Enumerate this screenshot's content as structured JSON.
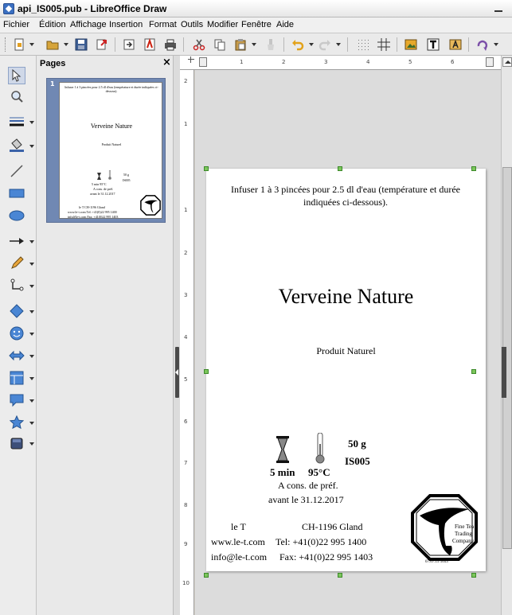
{
  "window": {
    "title": "api_IS005.pub - LibreOffice Draw"
  },
  "menu": [
    "Fichier",
    "Édition",
    "Affichage",
    "Insertion",
    "Format",
    "Outils",
    "Modifier",
    "Fenêtre",
    "Aide"
  ],
  "pages_panel": {
    "title": "Pages",
    "close": "×",
    "page_number": "1"
  },
  "ruler": {
    "h": [
      "1",
      "2",
      "3",
      "4",
      "5",
      "6"
    ],
    "v": [
      "2",
      "1",
      "1",
      "2",
      "3",
      "4",
      "5",
      "6",
      "7",
      "8",
      "9",
      "10"
    ]
  },
  "label": {
    "infuse": "Infuser 1 à 3 pincées pour 2.5 dl d'eau (température et durée indiquées ci-dessous).",
    "product_name": "Verveine Nature",
    "subtitle": "Produit Naturel",
    "weight": "50 g",
    "code": "IS005",
    "time": "5 min",
    "temperature": "95°C",
    "conservation": "A cons. de préf.",
    "best_before": "avant le 31.12.2017",
    "brand": "le T",
    "address": "CH-1196 Gland",
    "website": "www.le-t.com",
    "phone": "Tel: +41(0)22 995 1400",
    "email": "info@le-t.com",
    "fax": "Fax: +41(0)22 995 1403",
    "batch": "07.07.15 1053",
    "logo_text": [
      "Fine Tea",
      "Trading",
      "Company"
    ]
  },
  "thumbnail": {
    "infuse": "Infuser 1 à 3 pincées pour 2.5 dl d'eau (température et durée indiquées ci-dessous).",
    "product_name": "Verveine Nature",
    "subtitle": "Produit Naturel",
    "weight": "50 g",
    "code": "IS005",
    "time_temp": "5 min  95°C",
    "conservation": "A cons. de préf.",
    "best_before": "avant le 31.12.2017",
    "brand_addr": "le T          CH-1196 Gland",
    "web_tel": "www.le-t.com  Tel: +41(0)22 995 1400",
    "mail_fax": "info@le-t.com  Fax: +41(0)22 995 1403"
  },
  "colors": {
    "selection_handle": "#7cc65c",
    "thumb_frame": "#7088b3"
  }
}
